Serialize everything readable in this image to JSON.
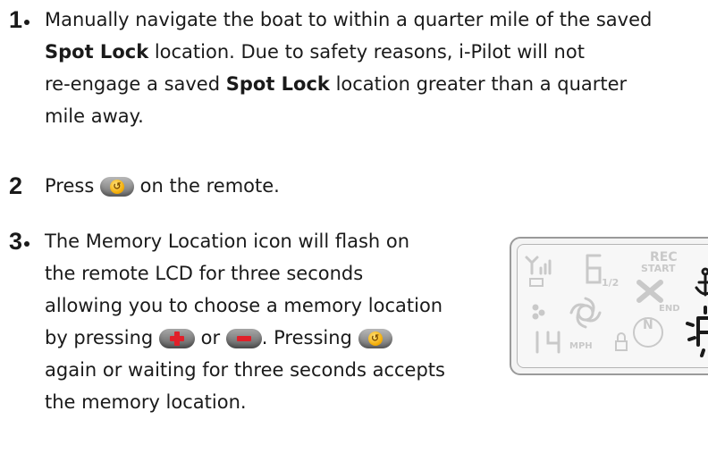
{
  "steps": [
    {
      "number": "1",
      "lines": [
        "Manually navigate the boat to within a quarter mile of the saved",
        [
          "",
          "Spot Lock",
          " location. Due to safety reasons, i-Pilot will not"
        ],
        [
          "re-engage a saved ",
          "Spot Lock",
          " location greater than a quarter"
        ],
        "mile away."
      ]
    },
    {
      "number": "2",
      "before": "Press",
      "after": "on the remote."
    },
    {
      "number": "3",
      "lines": [
        "The Memory Location icon will flash on",
        "the remote LCD for three seconds",
        "allowing you to choose a memory location"
      ],
      "line4_a": "by pressing",
      "line4_or": "or",
      "line4_b": ". Pressing",
      "line5": "again or waiting for three seconds accepts",
      "line6": "the memory location."
    }
  ],
  "lcd": {
    "mph": "MPH",
    "half": "1/2",
    "rec": "REC",
    "start": "START",
    "end": "END",
    "north": "N",
    "speed": "1.4"
  },
  "icons": {
    "spot_lock_button": "spot-lock-button-icon",
    "plus_button": "plus-button-icon",
    "minus_button": "minus-button-icon"
  },
  "colors": {
    "button_red": "#e0202a",
    "button_yellow": "#f2a900"
  }
}
